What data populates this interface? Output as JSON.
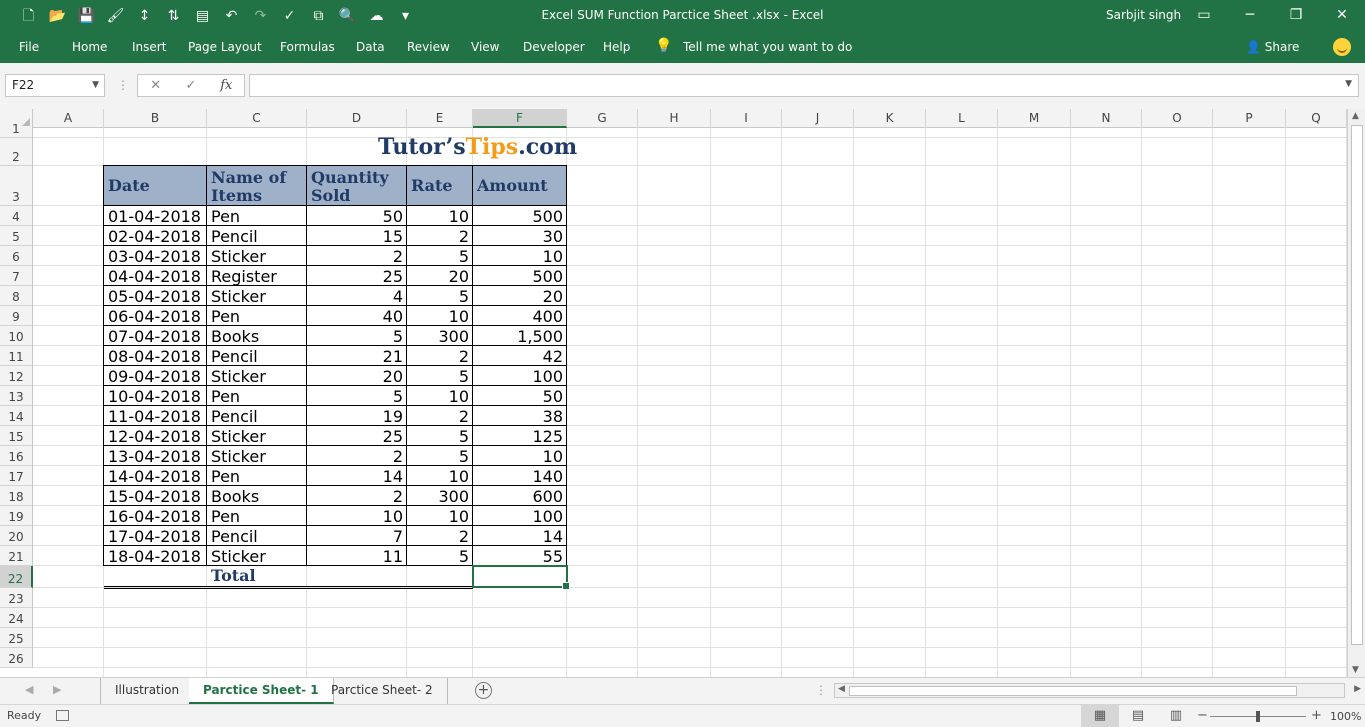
{
  "titlebar": {
    "document_title": "Excel SUM Function Parctice Sheet .xlsx  -  Excel",
    "user": "Sarbjit singh",
    "qat_icons": [
      "new-file-icon",
      "open-folder-icon",
      "save-icon",
      "format-painter-icon",
      "sort-ascending-icon",
      "sort-descending-icon",
      "form-icon",
      "undo-icon",
      "redo-icon",
      "spelling-icon",
      "paste-special-icon",
      "print-preview-icon",
      "cloud-icon",
      "customize-qat-icon"
    ]
  },
  "ribbon": {
    "tabs": [
      "File",
      "Home",
      "Insert",
      "Page Layout",
      "Formulas",
      "Data",
      "Review",
      "View",
      "Developer",
      "Help"
    ],
    "tell_me": "Tell me what you want to do",
    "share": "Share"
  },
  "formula_bar": {
    "name_box": "F22",
    "cancel_glyph": "✕",
    "enter_glyph": "✓",
    "fx_label": "fx",
    "formula": ""
  },
  "columns": [
    "A",
    "B",
    "C",
    "D",
    "E",
    "F",
    "G",
    "H",
    "I",
    "J",
    "K",
    "L",
    "M",
    "N",
    "O",
    "P",
    "Q"
  ],
  "rows": [
    "1",
    "2",
    "3",
    "4",
    "5",
    "6",
    "7",
    "8",
    "9",
    "10",
    "11",
    "12",
    "13",
    "14",
    "15",
    "16",
    "17",
    "18",
    "19",
    "20",
    "21",
    "22",
    "23",
    "24",
    "25",
    "26"
  ],
  "logo": {
    "part1": "Tutor’s",
    "part2": "Tips",
    "part3": ".com"
  },
  "table": {
    "headers": [
      "Date",
      "Name of Items",
      "Quantity Sold",
      "Rate",
      "Amount"
    ],
    "header_lines": {
      "date": "Date",
      "items_1": "Name of",
      "items_2": "Items",
      "qty_1": "Quantity",
      "qty_2": "Sold",
      "rate": "Rate",
      "amount": "Amount"
    },
    "rows": [
      [
        "01-04-2018",
        "Pen",
        "50",
        "10",
        "500"
      ],
      [
        "02-04-2018",
        "Pencil",
        "15",
        "2",
        "30"
      ],
      [
        "03-04-2018",
        "Sticker",
        "2",
        "5",
        "10"
      ],
      [
        "04-04-2018",
        "Register",
        "25",
        "20",
        "500"
      ],
      [
        "05-04-2018",
        "Sticker",
        "4",
        "5",
        "20"
      ],
      [
        "06-04-2018",
        "Pen",
        "40",
        "10",
        "400"
      ],
      [
        "07-04-2018",
        "Books",
        "5",
        "300",
        "1,500"
      ],
      [
        "08-04-2018",
        "Pencil",
        "21",
        "2",
        "42"
      ],
      [
        "09-04-2018",
        "Sticker",
        "20",
        "5",
        "100"
      ],
      [
        "10-04-2018",
        "Pen",
        "5",
        "10",
        "50"
      ],
      [
        "11-04-2018",
        "Pencil",
        "19",
        "2",
        "38"
      ],
      [
        "12-04-2018",
        "Sticker",
        "25",
        "5",
        "125"
      ],
      [
        "13-04-2018",
        "Sticker",
        "2",
        "5",
        "10"
      ],
      [
        "14-04-2018",
        "Pen",
        "14",
        "10",
        "140"
      ],
      [
        "15-04-2018",
        "Books",
        "2",
        "300",
        "600"
      ],
      [
        "16-04-2018",
        "Pen",
        "10",
        "10",
        "100"
      ],
      [
        "17-04-2018",
        "Pencil",
        "7",
        "2",
        "14"
      ],
      [
        "18-04-2018",
        "Sticker",
        "11",
        "5",
        "55"
      ]
    ],
    "total_label": "Total",
    "total_value": ""
  },
  "sheets": {
    "tabs": [
      "Illustration",
      "Parctice Sheet- 1",
      "Parctice Sheet- 2"
    ],
    "active": "Parctice Sheet- 1"
  },
  "status": {
    "ready": "Ready",
    "zoom": "100%"
  },
  "colors": {
    "excel_green": "#217346",
    "header_fill": "#9fb0c9",
    "header_text": "#1f3b66",
    "logo_orange": "#f39c1b"
  }
}
